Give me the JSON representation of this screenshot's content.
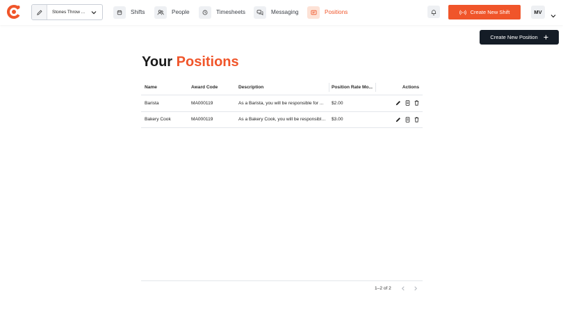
{
  "brand": {
    "accent": "#f0552a",
    "dark": "#141c26"
  },
  "header": {
    "venue_name": "Stones Throw ...",
    "nav": [
      {
        "label": "Shifts",
        "icon": "calendar-icon",
        "active": false
      },
      {
        "label": "People",
        "icon": "people-icon",
        "active": false
      },
      {
        "label": "Timesheets",
        "icon": "clock-icon",
        "active": false
      },
      {
        "label": "Messaging",
        "icon": "chat-icon",
        "active": false
      },
      {
        "label": "Positions",
        "icon": "id-card-icon",
        "active": true
      }
    ],
    "create_shift_label": "Create New Shift",
    "avatar_initials": "MV"
  },
  "page": {
    "create_position_label": "Create New Position",
    "title_plain": "Your",
    "title_accent": "Positions"
  },
  "table": {
    "columns": {
      "name": "Name",
      "award_code": "Award Code",
      "description": "Description",
      "rate": "Position Rate Mo...",
      "actions": "Actions"
    },
    "rows": [
      {
        "name": "Barista",
        "award_code": "MA000119",
        "description": "As a Barista, you will be responsible for ...",
        "rate": "$2.00"
      },
      {
        "name": "Bakery Cook",
        "award_code": "MA000119",
        "description": "As a Bakery Cook, you will be responsible ...",
        "rate": "$3.00"
      }
    ]
  },
  "pagination": {
    "range": "1–2 of 2"
  }
}
